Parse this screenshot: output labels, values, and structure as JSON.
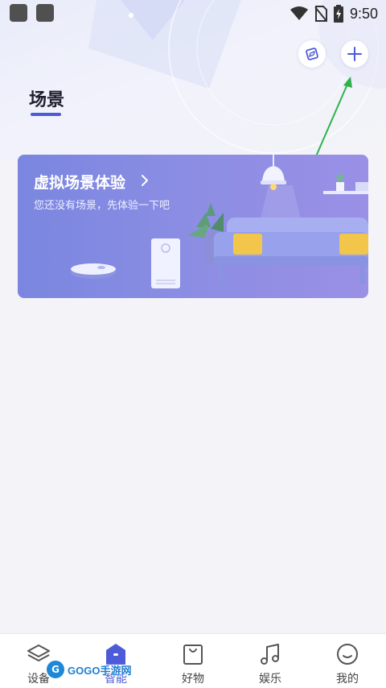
{
  "status_bar": {
    "time": "9:50"
  },
  "header": {
    "title": "场景",
    "explore_icon": "compass-icon",
    "add_icon": "plus-icon"
  },
  "banner": {
    "title": "虚拟场景体验",
    "subtitle": "您还没有场景，先体验一下吧"
  },
  "bottom_nav": {
    "items": [
      {
        "label": "设备",
        "icon": "device-layers-icon"
      },
      {
        "label": "智能",
        "icon": "smart-home-icon"
      },
      {
        "label": "好物",
        "icon": "shopping-bag-icon"
      },
      {
        "label": "娱乐",
        "icon": "music-note-icon"
      },
      {
        "label": "我的",
        "icon": "smile-icon"
      }
    ],
    "active_index": 1
  },
  "watermark": {
    "text": "GOGO手游网"
  },
  "colors": {
    "accent": "#4d5bd8",
    "banner_start": "#7a86e0",
    "banner_end": "#9a90e6",
    "annotation_arrow": "#2db34a"
  }
}
